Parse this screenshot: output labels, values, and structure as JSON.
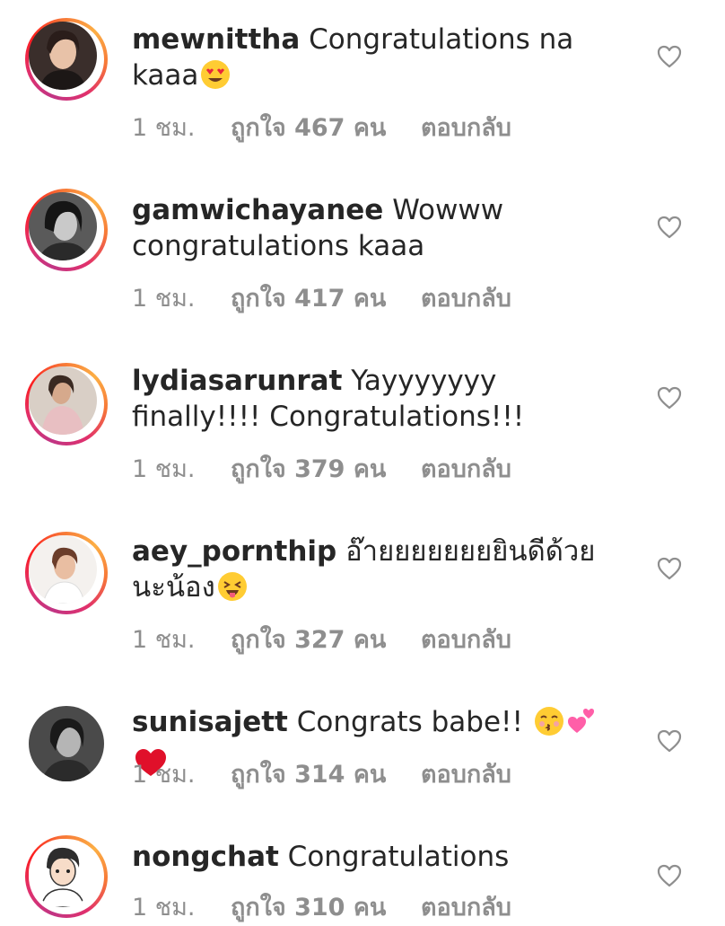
{
  "comments": [
    {
      "username": "mewnittha",
      "text": "Congratulations na kaaa",
      "emoji": "heart-eyes",
      "time": "1 ชม.",
      "likes": "ถูกใจ 467 คน",
      "reply": "ตอบกลับ",
      "story_ring": true
    },
    {
      "username": "gamwichayanee",
      "text": "Wowww congratulations kaaa",
      "time": "1 ชม.",
      "likes": "ถูกใจ 417 คน",
      "reply": "ตอบกลับ",
      "story_ring": true
    },
    {
      "username": "lydiasarunrat",
      "text": "Yayyyyyyy finally!!!! Congratulations!!!",
      "time": "1 ชม.",
      "likes": "ถูกใจ 379 คน",
      "reply": "ตอบกลับ",
      "story_ring": true
    },
    {
      "username": "aey_pornthip",
      "text": "อ๊ายยยยยยยยินดีด้วยนะน้อง",
      "emoji": "tongue-wink",
      "time": "1 ชม.",
      "likes": "ถูกใจ 327 คน",
      "reply": "ตอบกลับ",
      "story_ring": true
    },
    {
      "username": "sunisajett",
      "text": "Congrats babe!!",
      "emoji": "kiss-hearts",
      "time": "1 ชม.",
      "likes": "ถูกใจ 314 คน",
      "reply": "ตอบกลับ",
      "story_ring": false
    },
    {
      "username": "nongchat",
      "text": "Congratulations",
      "time": "1 ชม.",
      "likes": "ถูกใจ 310 คน",
      "reply": "ตอบกลับ",
      "story_ring": true
    }
  ],
  "colors": {
    "text": "#262626",
    "meta": "#8e8e8e",
    "ring_start": "#c13584",
    "ring_end": "#fcaf45",
    "heart_outline": "#8e8e8e"
  }
}
